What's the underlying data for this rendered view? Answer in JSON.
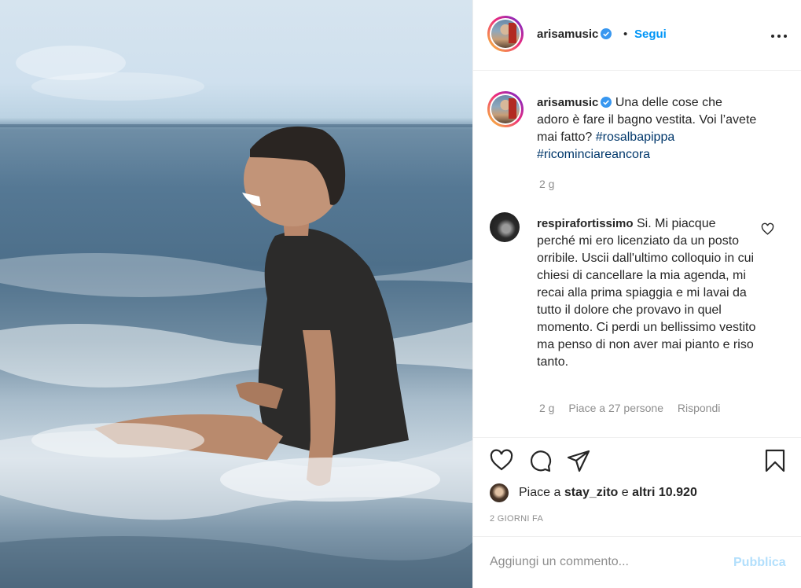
{
  "post": {
    "username": "arisamusic",
    "verified": true,
    "separator": "•",
    "follow_label": "Segui",
    "more_icon": "more-horizontal-icon"
  },
  "caption": {
    "username": "arisamusic",
    "text": "Una delle cose che adoro è fare il bagno vestita. Voi l’avete mai fatto?",
    "hashtags": [
      "#rosalbapippa",
      "#ricominciareancora"
    ],
    "time": "2 g"
  },
  "comment": {
    "username": "respirafortissimo",
    "text": "Si. Mi piacque perché mi ero licenziato da un posto orribile. Uscii dall'ultimo colloquio in cui chiesi di cancellare la mia agenda, mi recai alla prima spiaggia e mi lavai da tutto il dolore che provavo in quel momento. Ci perdi un bellissimo vestito ma penso di non aver mai pianto e riso tanto.",
    "time": "2 g",
    "likes": "Piace a 27 persone",
    "reply_label": "Rispondi"
  },
  "likes": {
    "prefix": "Piace a",
    "user": "stay_zito",
    "connector": "e",
    "others": "altri 10.920"
  },
  "posted_ago": "2 GIORNI FA",
  "comment_box": {
    "placeholder": "Aggiungi un commento...",
    "publish_label": "Pubblica"
  },
  "colors": {
    "accent": "#0095f6",
    "hashtag": "#00376b",
    "muted": "#8e8e8e",
    "publish_disabled": "#b2dffc",
    "verified": "#3897f0"
  }
}
